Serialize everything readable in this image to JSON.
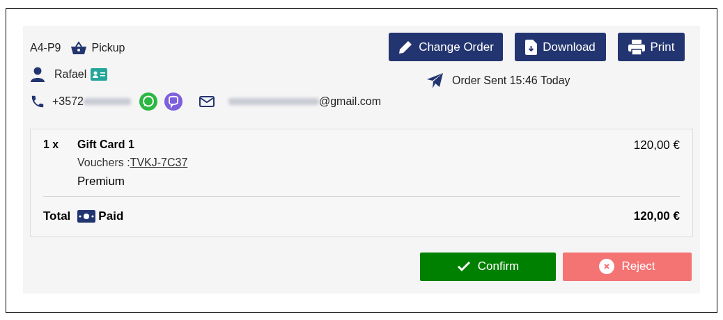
{
  "order_code": "A4-P9",
  "delivery": "Pickup",
  "customer": {
    "name": "Rafael",
    "phone_prefix": "+3572",
    "email_domain": "@gmail.com"
  },
  "actions": [
    {
      "kind": "edit",
      "label": "Change Order"
    },
    {
      "kind": "download",
      "label": "Download"
    },
    {
      "kind": "print",
      "label": "Print"
    }
  ],
  "sent_status": "Order Sent 15:46 Today",
  "items": [
    {
      "quantity": "1 x",
      "name": "Gift Card 1",
      "voucher_label": "Vouchers :",
      "voucher_code": "TVKJ-7C37",
      "variant": "Premium",
      "price": "120,00 €"
    }
  ],
  "total": {
    "label": "Total",
    "payment": "Paid",
    "amount": "120,00 €"
  },
  "buttons": [
    {
      "kind": "confirm",
      "label": "Confirm"
    },
    {
      "kind": "reject",
      "label": "Reject"
    }
  ]
}
